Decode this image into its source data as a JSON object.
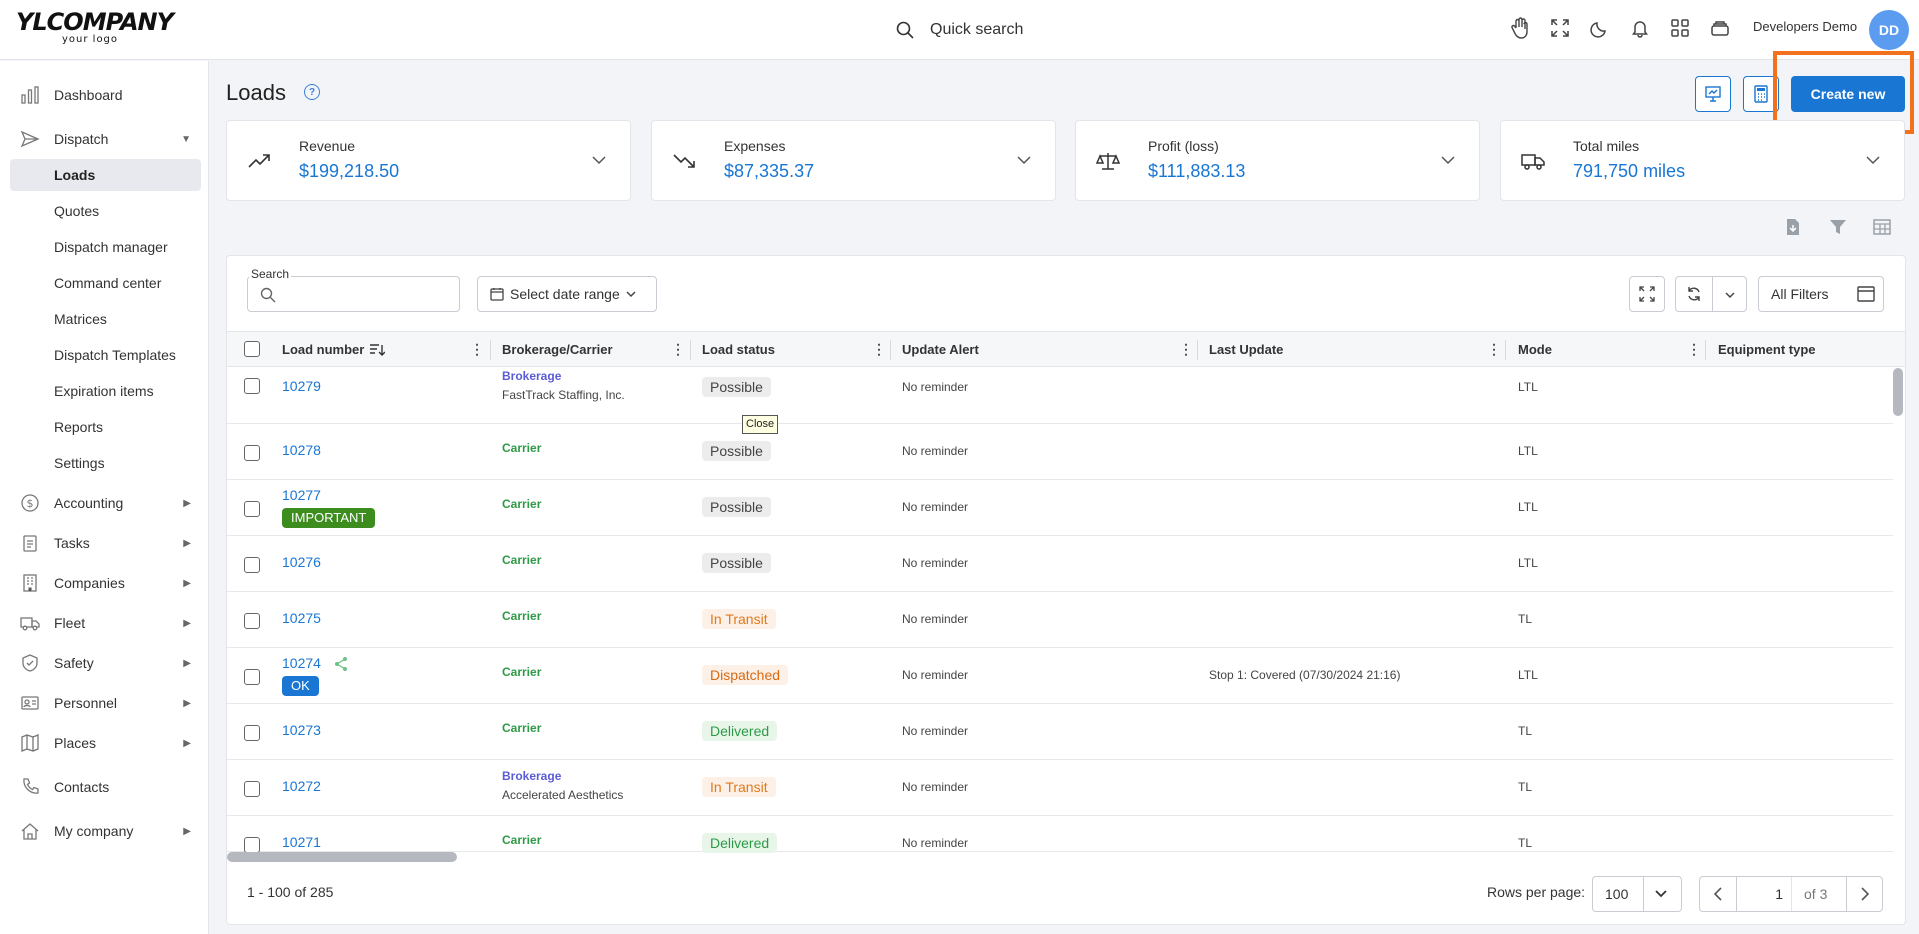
{
  "app": {
    "logo_main": "YLCOMPANY",
    "logo_sub": "your logo",
    "quick_search": "Quick search",
    "user_name": "Developers Demo",
    "user_initials": "DD"
  },
  "sidebar": {
    "dashboard": "Dashboard",
    "dispatch": "Dispatch",
    "dispatch_sub": [
      "Loads",
      "Quotes",
      "Dispatch manager",
      "Command center",
      "Matrices",
      "Dispatch Templates",
      "Expiration items",
      "Reports",
      "Settings"
    ],
    "accounting": "Accounting",
    "tasks": "Tasks",
    "companies": "Companies",
    "fleet": "Fleet",
    "safety": "Safety",
    "personnel": "Personnel",
    "places": "Places",
    "contacts": "Contacts",
    "my_company": "My company"
  },
  "page": {
    "title": "Loads",
    "create_label": "Create new"
  },
  "stats": [
    {
      "label": "Revenue",
      "value": "$199,218.50"
    },
    {
      "label": "Expenses",
      "value": "$87,335.37"
    },
    {
      "label": "Profit (loss)",
      "value": "$111,883.13"
    },
    {
      "label": "Total miles",
      "value": "791,750 miles"
    }
  ],
  "filters": {
    "search_label": "Search",
    "search_value": "",
    "date_range": "Select date range",
    "all_filters": "All Filters"
  },
  "columns": [
    "Load number",
    "Brokerage/Carrier",
    "Load status",
    "Update Alert",
    "Last Update",
    "Mode",
    "Equipment type"
  ],
  "rows": [
    {
      "load": "10279",
      "type": "Brokerage",
      "name": "FastTrack Staffing, Inc.",
      "status": "Possible",
      "alert": "No reminder",
      "last": "",
      "mode": "LTL",
      "tag": ""
    },
    {
      "load": "10278",
      "type": "Carrier",
      "name": "",
      "status": "Possible",
      "alert": "No reminder",
      "last": "",
      "mode": "LTL",
      "tag": ""
    },
    {
      "load": "10277",
      "type": "Carrier",
      "name": "",
      "status": "Possible",
      "alert": "No reminder",
      "last": "",
      "mode": "LTL",
      "tag": "IMPORTANT"
    },
    {
      "load": "10276",
      "type": "Carrier",
      "name": "",
      "status": "Possible",
      "alert": "No reminder",
      "last": "",
      "mode": "LTL",
      "tag": ""
    },
    {
      "load": "10275",
      "type": "Carrier",
      "name": "",
      "status": "In Transit",
      "alert": "No reminder",
      "last": "",
      "mode": "TL",
      "tag": ""
    },
    {
      "load": "10274",
      "type": "Carrier",
      "name": "",
      "status": "Dispatched",
      "alert": "No reminder",
      "last": "Stop 1: Covered (07/30/2024 21:16)",
      "mode": "LTL",
      "tag": "OK"
    },
    {
      "load": "10273",
      "type": "Carrier",
      "name": "",
      "status": "Delivered",
      "alert": "No reminder",
      "last": "",
      "mode": "TL",
      "tag": ""
    },
    {
      "load": "10272",
      "type": "Brokerage",
      "name": "Accelerated Aesthetics",
      "status": "In Transit",
      "alert": "No reminder",
      "last": "",
      "mode": "TL",
      "tag": ""
    },
    {
      "load": "10271",
      "type": "Carrier",
      "name": "",
      "status": "Delivered",
      "alert": "No reminder",
      "last": "",
      "mode": "TL",
      "tag": ""
    }
  ],
  "tooltip": "Close",
  "footer": {
    "count": "1 - 100 of 285",
    "rows_per_page_label": "Rows per page:",
    "rows_per_page": "100",
    "page": "1",
    "of_pages": "of 3"
  },
  "colors": {
    "accent": "#1976d2",
    "highlight": "#f2711c",
    "carrier": "#2e9a46",
    "brokerage": "#5b5bd6"
  }
}
